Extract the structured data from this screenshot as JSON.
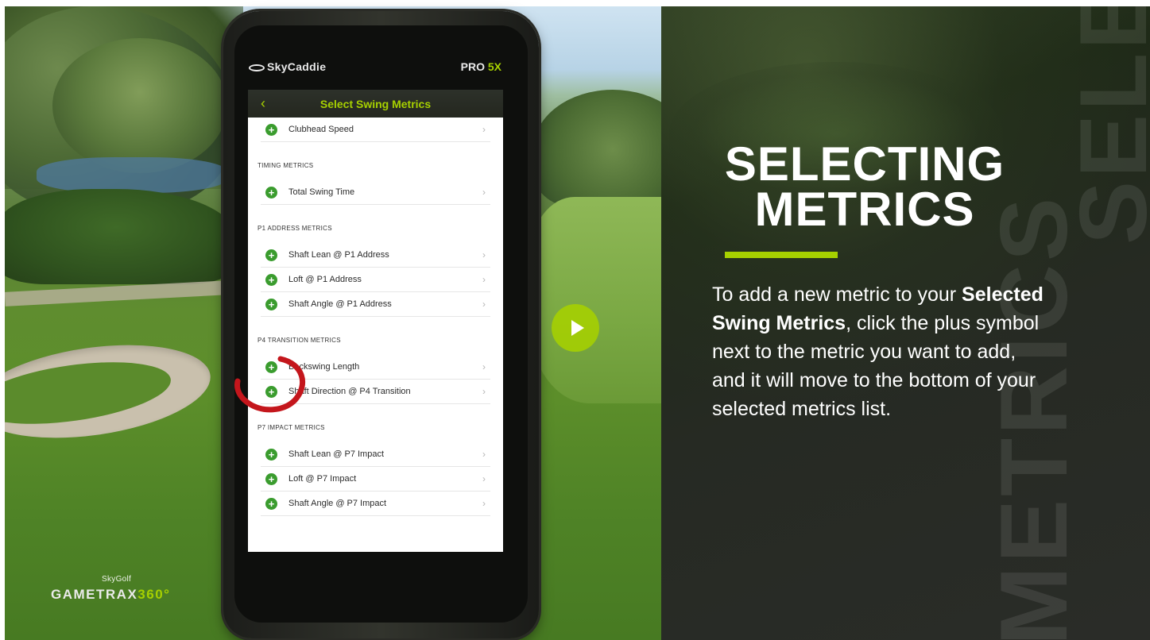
{
  "app": {
    "brand_small": "SkyGolf",
    "brand_big_pre": "GAMETRAX",
    "brand_big_accent": "360°"
  },
  "phone": {
    "logo": "SkyCaddie",
    "model_pre": "PRO ",
    "model_accent": "5X",
    "screen_title": "Select Swing Metrics",
    "back_icon": "chevron-left-icon",
    "rows": [
      {
        "label": "Clubhead Speed"
      },
      {
        "section": "TIMING METRICS"
      },
      {
        "label": "Total Swing Time"
      },
      {
        "section": "P1 ADDRESS METRICS"
      },
      {
        "label": "Shaft Lean @ P1 Address"
      },
      {
        "label": "Loft @ P1 Address"
      },
      {
        "label": "Shaft Angle @ P1 Address"
      },
      {
        "section": "P4 TRANSITION METRICS"
      },
      {
        "label": "Backswing Length"
      },
      {
        "label": "Shaft Direction @ P4 Transition"
      },
      {
        "section": "P7 IMPACT METRICS"
      },
      {
        "label": "Shaft Lean @ P7 Impact"
      },
      {
        "label": "Loft @ P7 Impact"
      },
      {
        "label": "Shaft Angle @ P7 Impact"
      }
    ]
  },
  "panel": {
    "heading_line1": "SELECTING",
    "heading_line2": "METRICS",
    "desc_pre": "To add a new metric to your ",
    "desc_bold": "Selected Swing Metrics",
    "desc_post": ", click the plus symbol next to the metric you want to add, and it will move to the bottom of your selected metrics list.",
    "watermark1": "SELECTING",
    "watermark2": "METRICS"
  },
  "colors": {
    "accent": "#a6d000",
    "plus_green": "#3a9c2e",
    "annotation_red": "#c4161c"
  }
}
